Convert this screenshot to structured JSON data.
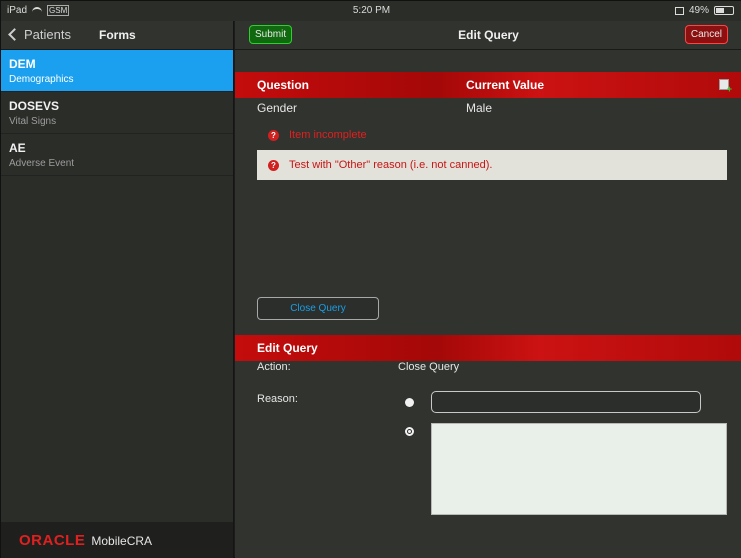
{
  "status_bar": {
    "device": "iPad",
    "carrier_label": "GSM",
    "time": "5:20 PM",
    "battery_percent": "49%",
    "battery_level": 0.49
  },
  "left_pane": {
    "back_label": "Patients",
    "title": "Forms",
    "forms": [
      {
        "code": "DEM",
        "name": "Demographics",
        "selected": true
      },
      {
        "code": "DOSEVS",
        "name": "Vital Signs",
        "selected": false
      },
      {
        "code": "AE",
        "name": "Adverse Event",
        "selected": false
      }
    ],
    "brand": {
      "logo_text": "ORACLE",
      "app_name": "MobileCRA"
    }
  },
  "right_pane": {
    "title": "Edit Query",
    "submit_label": "Submit",
    "cancel_label": "Cancel",
    "table": {
      "col_question": "Question",
      "col_value": "Current Value",
      "question": "Gender",
      "value": "Male"
    },
    "issues": [
      {
        "text": "Item incomplete"
      },
      {
        "text": "Test with \"Other\" reason (i.e. not canned)."
      }
    ],
    "close_query_label": "Close Query",
    "edit_section": {
      "header": "Edit Query",
      "action_label": "Action:",
      "action_value": "Close Query",
      "reason_label": "Reason:",
      "reason_input_value": "",
      "reason_text_value": ""
    }
  },
  "colors": {
    "accent_blue": "#1aa0ef",
    "header_red": "#c40c0c",
    "submit_green": "#11690f",
    "cancel_red": "#8c1010"
  },
  "icons": [
    "wifi-icon",
    "battery-icon",
    "orientation-lock-icon",
    "back-chevron-icon",
    "add-note-icon",
    "error-icon"
  ]
}
